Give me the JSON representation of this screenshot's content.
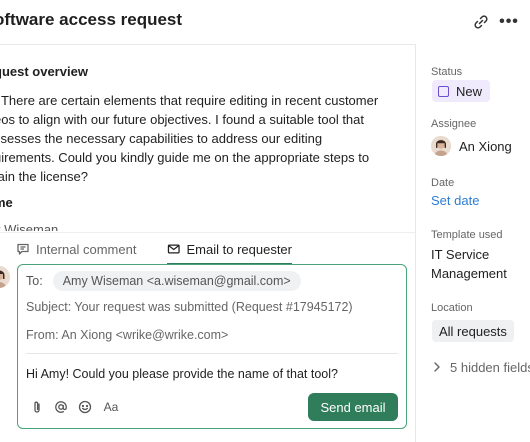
{
  "header": {
    "title": "oftware access request",
    "link_icon": "link-icon",
    "more_icon": "more-icon"
  },
  "overview": {
    "title": "quest overview",
    "lines": [
      ". There are certain elements that require editing in recent customer",
      "eos to align with our future objectives. I found a suitable tool that",
      "ssesses the necessary capabilities to address our editing",
      "uirements. Could you kindly guide me on the appropriate steps to",
      "tain the license?"
    ]
  },
  "name_field": {
    "title": "me",
    "value": "y Wiseman"
  },
  "tabs": [
    {
      "label": "Internal comment",
      "icon": "comment-icon"
    },
    {
      "label": "Email to requester",
      "icon": "mail-icon"
    }
  ],
  "composer": {
    "to_label": "To:",
    "to_value": "Amy Wiseman <a.wiseman@gmail.com>",
    "subject": "Subject: Your request was submitted (Request #17945172)",
    "from": "From: An Xiong <wrike@wrike.com>",
    "message": "Hi Amy! Could you please provide the name of that tool?",
    "tools": [
      "attach-icon",
      "mention-icon",
      "emoji-icon",
      "text-format-icon"
    ],
    "format_label": "Aa",
    "send_label": "Send email"
  },
  "side": {
    "status_label": "Status",
    "status_value": "New",
    "assignee_label": "Assignee",
    "assignee_value": "An Xiong",
    "date_label": "Date",
    "date_value": "Set date",
    "template_label": "Template used",
    "template_value_1": "IT Service",
    "template_value_2": "Management",
    "location_label": "Location",
    "location_value": "All requests",
    "hidden_fields": "5 hidden fields"
  },
  "colors": {
    "accent_green": "#2f7d5a",
    "composer_border": "#4aa37a",
    "status_purple": "#6a4fd0",
    "link_blue": "#2d7dd2"
  }
}
